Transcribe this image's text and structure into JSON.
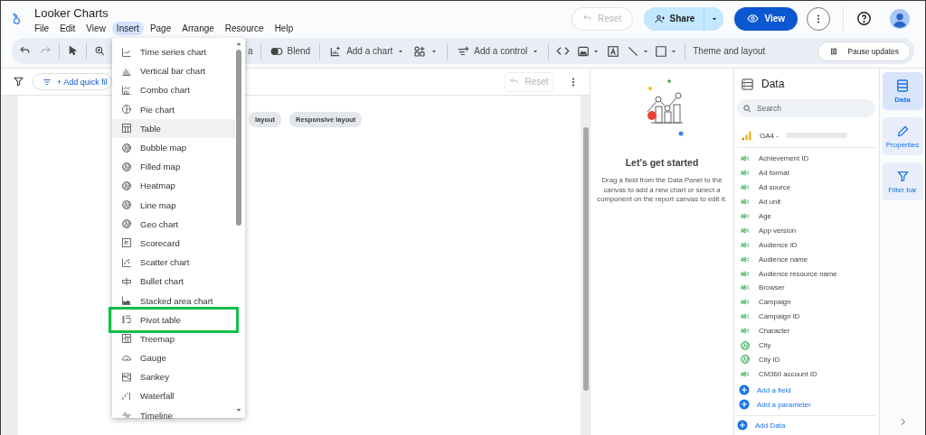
{
  "app": {
    "title": "Looker Charts",
    "menu": [
      {
        "label": "File",
        "selected": false
      },
      {
        "label": "Edit",
        "selected": false
      },
      {
        "label": "View",
        "selected": false
      },
      {
        "label": "Insert",
        "selected": true
      },
      {
        "label": "Page",
        "selected": false
      },
      {
        "label": "Arrange",
        "selected": false
      },
      {
        "label": "Resource",
        "selected": false
      },
      {
        "label": "Help",
        "selected": false
      }
    ],
    "reset_button": {
      "label": "Reset",
      "disabled": true
    },
    "share_button": {
      "label": "Share"
    },
    "view_button": {
      "label": "View"
    }
  },
  "toolbar": {
    "covered_label": "a",
    "blend": "Blend",
    "add_chart": "Add a chart",
    "add_control": "Add a control",
    "theme_and_layout": "Theme and layout",
    "pause_updates": "Pause updates"
  },
  "filter_bar": {
    "add_quick_filter": "+ Add quick fil",
    "reset_button": {
      "label": "Reset",
      "disabled": true
    }
  },
  "canvas": {
    "layout_chips": [
      "layout",
      "Responsive layout"
    ]
  },
  "insert_menu": {
    "items": [
      {
        "label": "Time series chart",
        "kind": "line",
        "hovered": false,
        "highlighted": false
      },
      {
        "label": "Vertical bar chart",
        "kind": "bar",
        "hovered": false,
        "highlighted": false
      },
      {
        "label": "Combo chart",
        "kind": "combo",
        "hovered": false,
        "highlighted": false
      },
      {
        "label": "Pie chart",
        "kind": "pie",
        "hovered": false,
        "highlighted": false
      },
      {
        "label": "Table",
        "kind": "table",
        "hovered": true,
        "highlighted": false
      },
      {
        "label": "Bubble map",
        "kind": "globe",
        "hovered": false,
        "highlighted": false
      },
      {
        "label": "Filled map",
        "kind": "globe",
        "hovered": false,
        "highlighted": false
      },
      {
        "label": "Heatmap",
        "kind": "globe",
        "hovered": false,
        "highlighted": false
      },
      {
        "label": "Line map",
        "kind": "globe",
        "hovered": false,
        "highlighted": false
      },
      {
        "label": "Geo chart",
        "kind": "globe",
        "hovered": false,
        "highlighted": false
      },
      {
        "label": "Scorecard",
        "kind": "scorecard",
        "hovered": false,
        "highlighted": false
      },
      {
        "label": "Scatter chart",
        "kind": "scatter",
        "hovered": false,
        "highlighted": false
      },
      {
        "label": "Bullet chart",
        "kind": "bullet",
        "hovered": false,
        "highlighted": false
      },
      {
        "label": "Stacked area chart",
        "kind": "area",
        "hovered": false,
        "highlighted": false
      },
      {
        "label": "Pivot table",
        "kind": "pivot",
        "hovered": false,
        "highlighted": true
      },
      {
        "label": "Treemap",
        "kind": "treemap",
        "hovered": false,
        "highlighted": false
      },
      {
        "label": "Gauge",
        "kind": "gauge",
        "hovered": false,
        "highlighted": false
      },
      {
        "label": "Sankey",
        "kind": "sankey",
        "hovered": false,
        "highlighted": false
      },
      {
        "label": "Waterfall",
        "kind": "waterfall",
        "hovered": false,
        "highlighted": false
      },
      {
        "label": "Timeline",
        "kind": "timeline",
        "hovered": false,
        "highlighted": false
      }
    ]
  },
  "start_panel": {
    "title": "Let's get started",
    "text": "Drag a field from the Data Panel to the canvas to add a new chart or select a component on the report canvas to edit it."
  },
  "data_panel": {
    "title": "Data",
    "search": {
      "placeholder": "Search"
    },
    "source": "GA4 -",
    "fields": [
      {
        "name": "Achievement ID",
        "kind": "text"
      },
      {
        "name": "Ad format",
        "kind": "text"
      },
      {
        "name": "Ad source",
        "kind": "text"
      },
      {
        "name": "Ad unit",
        "kind": "text"
      },
      {
        "name": "Age",
        "kind": "text"
      },
      {
        "name": "App version",
        "kind": "text"
      },
      {
        "name": "Audience ID",
        "kind": "text"
      },
      {
        "name": "Audience name",
        "kind": "text"
      },
      {
        "name": "Audience resource name",
        "kind": "text"
      },
      {
        "name": "Browser",
        "kind": "text"
      },
      {
        "name": "Campaign",
        "kind": "text"
      },
      {
        "name": "Campaign ID",
        "kind": "text"
      },
      {
        "name": "Character",
        "kind": "text"
      },
      {
        "name": "City",
        "kind": "geo"
      },
      {
        "name": "City ID",
        "kind": "geo"
      },
      {
        "name": "CM360 account ID",
        "kind": "text"
      }
    ],
    "actions": [
      "Add a field",
      "Add a parameter"
    ],
    "add_data": "Add Data"
  },
  "side_rail": {
    "tabs": [
      {
        "label": "Data",
        "kind": "data",
        "selected": true
      },
      {
        "label": "Properties",
        "kind": "properties",
        "selected": false
      },
      {
        "label": "Filter bar",
        "kind": "filter",
        "selected": false
      }
    ]
  }
}
